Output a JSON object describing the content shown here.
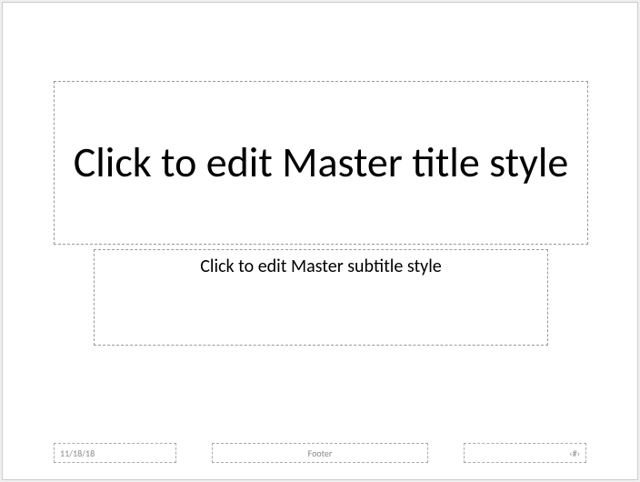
{
  "slide": {
    "title_placeholder": "Click to edit Master title style",
    "subtitle_placeholder": "Click to edit Master subtitle style"
  },
  "footer": {
    "date": "11/18/18",
    "center": "Footer",
    "page": "‹#›"
  }
}
